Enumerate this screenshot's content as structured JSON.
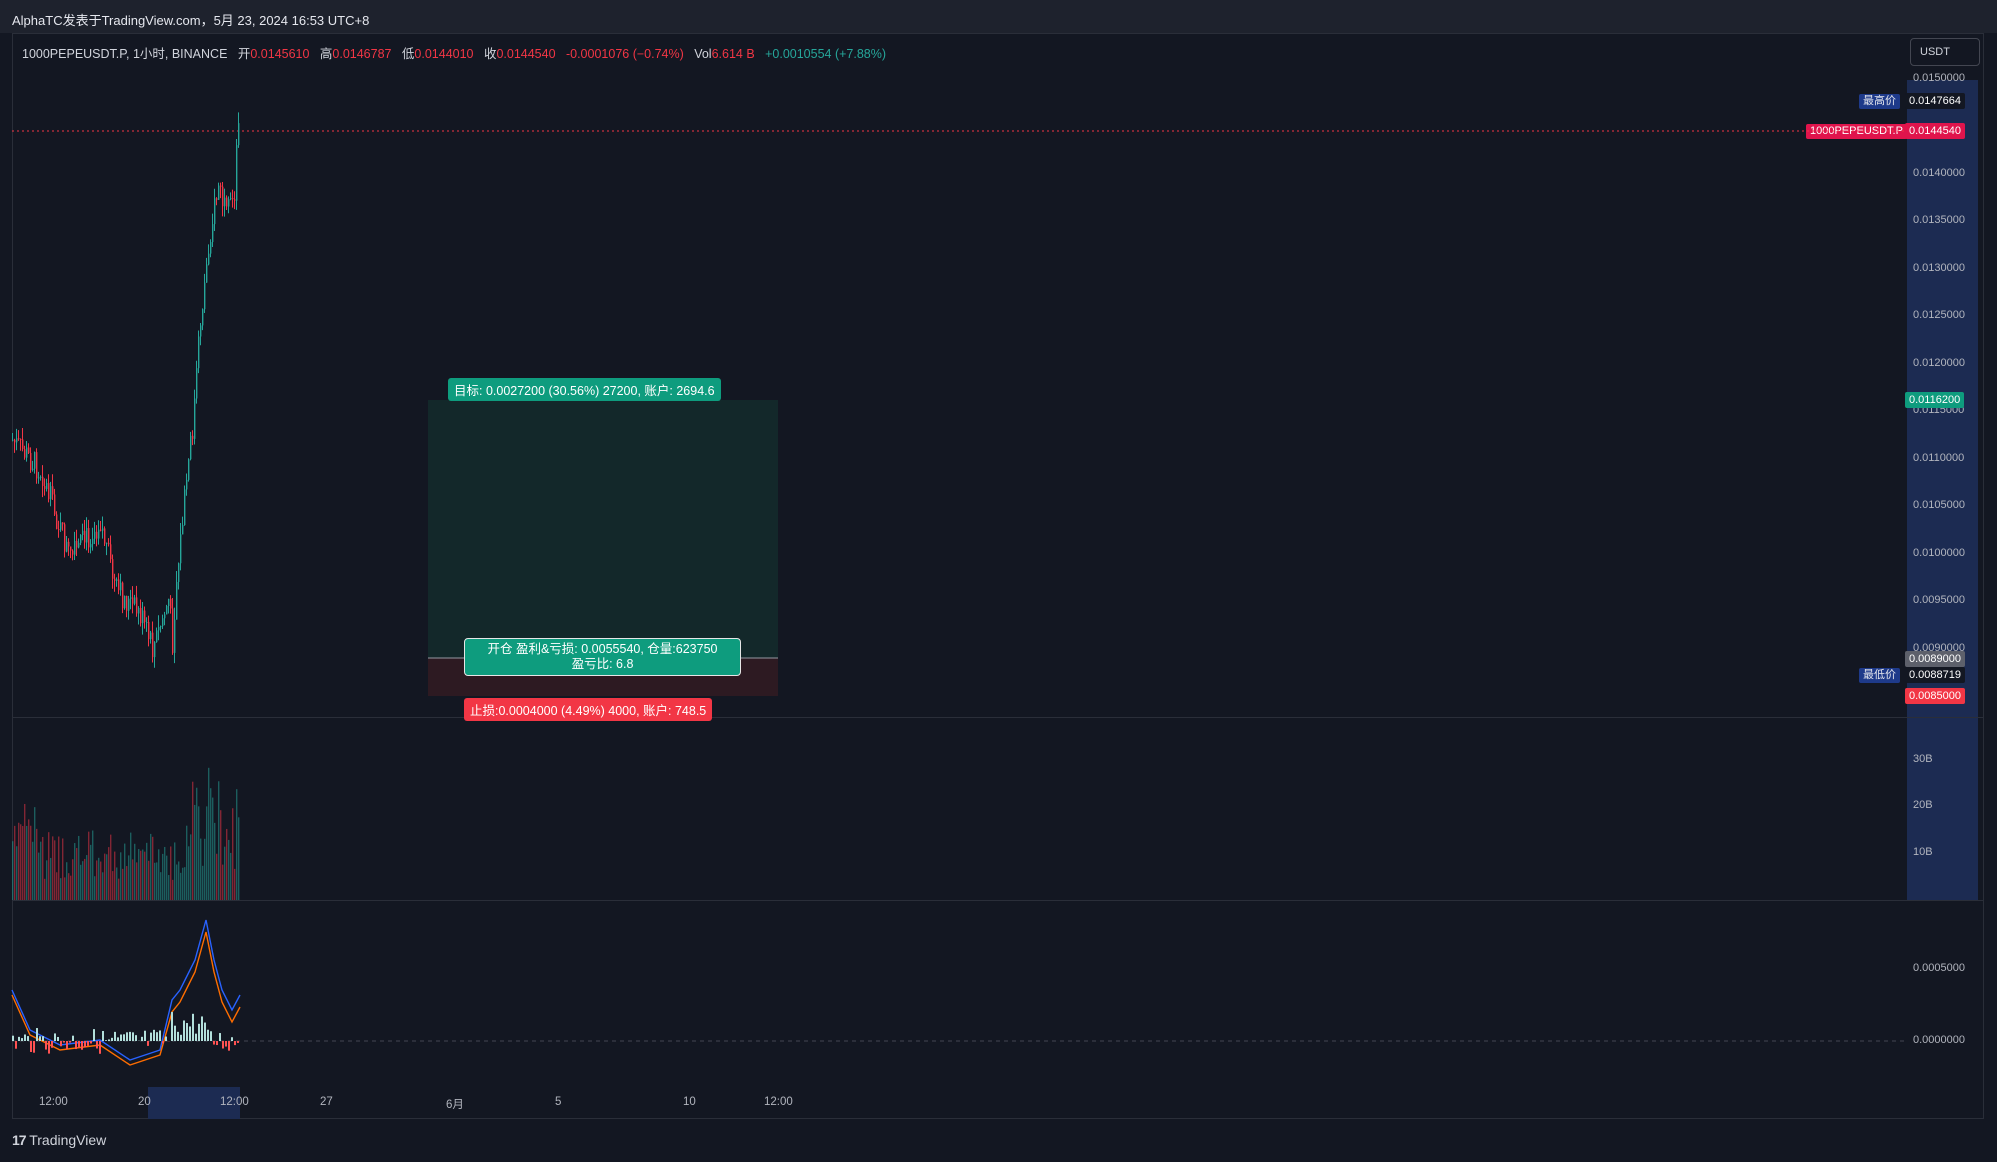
{
  "header": {
    "title": "AlphaTC发表于TradingView.com，5月 23, 2024 16:53 UTC+8"
  },
  "legend": {
    "symbol": "1000PEPEUSDT.P, 1小时, BINANCE",
    "open_label": "开",
    "open": "0.0145610",
    "high_label": "高",
    "high": "0.0146787",
    "low_label": "低",
    "low": "0.0144010",
    "close_label": "收",
    "close": "0.0144540",
    "change": "-0.0001076 (−0.74%)",
    "vol_label": "Vol",
    "vol": "6.614 B",
    "vol_change": "+0.0010554 (+7.88%)"
  },
  "price_axis": {
    "currency": "USDT",
    "ticks": [
      "0.0150000",
      "0.0140000",
      "0.0135000",
      "0.0130000",
      "0.0125000",
      "0.0120000",
      "0.0115000",
      "0.0110000",
      "0.0105000",
      "0.0100000",
      "0.0095000",
      "0.0090000"
    ],
    "high_tag": "最高价",
    "high_value": "0.0147664",
    "low_tag": "最低价",
    "low_value": "0.0088719",
    "symbol_tag": "1000PEPEUSDT.P",
    "current_price": "0.0144540",
    "target_price": "0.0116200",
    "entry_price": "0.0089000",
    "stop_price": "0.0085000"
  },
  "volume_axis": {
    "ticks": [
      "30B",
      "20B",
      "10B"
    ]
  },
  "macd_axis": {
    "ticks": [
      "0.0005000",
      "0.0000000"
    ]
  },
  "time_axis": {
    "labels": [
      "12:00",
      "20",
      "12:00",
      "27",
      "6月",
      "5",
      "10",
      "12:00"
    ]
  },
  "position": {
    "target_label": "目标: 0.0027200 (30.56%) 27200, 账户: 2694.6",
    "entry_line1": "开仓 盈利&亏损: 0.0055540, 仓量:623750",
    "entry_line2": "盈亏比: 6.8",
    "stop_label": "止损:0.0004000 (4.49%) 4000, 账户: 748.5"
  },
  "footer": {
    "brand": "TradingView"
  },
  "colors": {
    "up": "#26a69a",
    "down": "#f23645",
    "profit_zone": "#13282a",
    "loss_zone": "#2d1a22",
    "axis_highlight": "#1c2b52"
  }
}
